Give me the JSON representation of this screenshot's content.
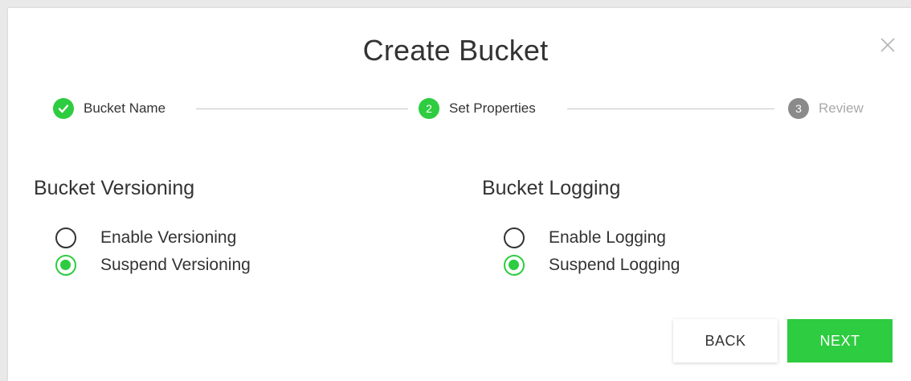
{
  "dialog": {
    "title": "Create Bucket",
    "close_icon": "close-icon"
  },
  "stepper": {
    "steps": [
      {
        "label": "Bucket Name",
        "marker": "",
        "state": "done",
        "icon": "check-icon"
      },
      {
        "label": "Set Properties",
        "marker": "2",
        "state": "active"
      },
      {
        "label": "Review",
        "marker": "3",
        "state": "pending"
      }
    ]
  },
  "versioning": {
    "title": "Bucket Versioning",
    "options": [
      {
        "label": "Enable Versioning",
        "checked": false
      },
      {
        "label": "Suspend Versioning",
        "checked": true
      }
    ]
  },
  "logging": {
    "title": "Bucket Logging",
    "options": [
      {
        "label": "Enable Logging",
        "checked": false
      },
      {
        "label": "Suspend Logging",
        "checked": true
      }
    ]
  },
  "actions": {
    "back_label": "BACK",
    "next_label": "NEXT"
  },
  "colors": {
    "accent": "#2ecc40",
    "pending": "#8a8a8a",
    "text": "#333333",
    "muted": "#a9a9a9"
  }
}
